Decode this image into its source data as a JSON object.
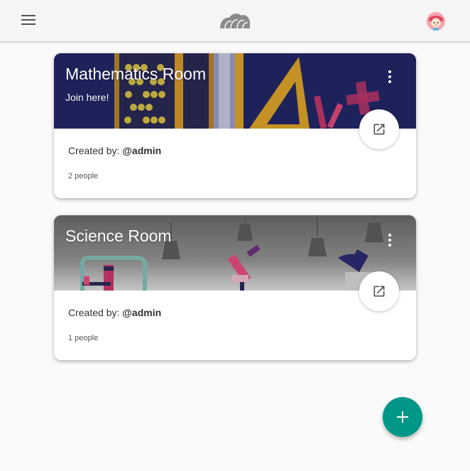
{
  "topbar": {
    "menu_icon": "hamburger-menu-icon",
    "logo_icon": "cloud-logo-icon",
    "avatar_icon": "user-avatar-icon"
  },
  "rooms": [
    {
      "title": "Mathematics Room",
      "subtitle": "Join here!",
      "created_prefix": "Created by: ",
      "creator": "@admin",
      "people": "2 people",
      "theme_color": "#1d1f5e"
    },
    {
      "title": "Science Room",
      "created_prefix": "Created by: ",
      "creator": "@admin",
      "people": "1 people",
      "theme_color": "#6e6e6e"
    }
  ],
  "fab": {
    "label": "+",
    "color": "#009688"
  }
}
